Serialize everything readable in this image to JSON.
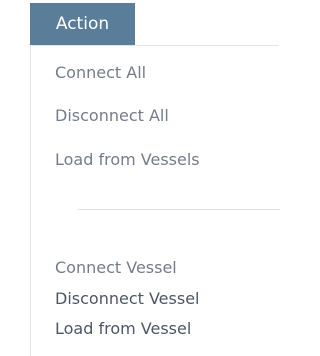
{
  "menu": {
    "title": "Action",
    "group1": [
      {
        "label": "Connect All"
      },
      {
        "label": "Disconnect All"
      },
      {
        "label": "Load from Vessels"
      }
    ],
    "group2": [
      {
        "label": "Connect Vessel"
      },
      {
        "label": "Disconnect Vessel"
      },
      {
        "label": "Load from Vessel"
      }
    ],
    "colors": {
      "header_background": "#5a7d99",
      "header_text": "#ffffff",
      "item_text": "#4d5766",
      "item_text_muted": "#747d89",
      "separator": "#dfe3e7"
    }
  }
}
